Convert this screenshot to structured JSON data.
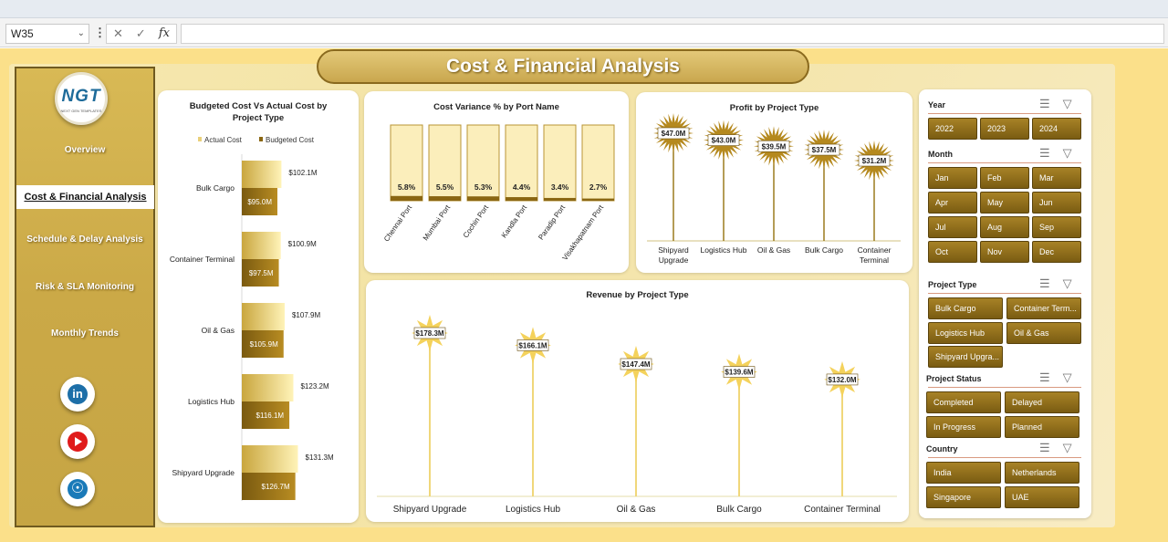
{
  "excel": {
    "name_box": "W35",
    "fx_label": "fx"
  },
  "title": "Cost & Financial Analysis",
  "logo": {
    "text": "NGT",
    "sub": "NEXT GEN TEMPLATES"
  },
  "nav": [
    {
      "label": "Overview"
    },
    {
      "label": "Cost & Financial Analysis"
    },
    {
      "label": "Schedule & Delay Analysis"
    },
    {
      "label": "Risk & SLA Monitoring"
    },
    {
      "label": "Monthly Trends"
    }
  ],
  "social": {
    "linkedin": "in"
  },
  "colors": {
    "gold_dark": "#8a6612",
    "gold_light": "#f4e3a0",
    "stem": "#b8922a"
  },
  "charts": {
    "budget": {
      "title_line1": "Budgeted Cost Vs Actual Cost by",
      "title_line2": "Project Type",
      "legend_actual": "Actual Cost",
      "legend_budget": "Budgeted Cost",
      "labels": [
        "$102.1M",
        "$95.0M",
        "$100.9M",
        "$97.5M",
        "$107.9M",
        "$105.9M",
        "$123.2M",
        "$116.1M",
        "$131.3M",
        "$126.7M"
      ]
    },
    "variance": {
      "title": "Cost Variance % by Port Name",
      "labels": [
        "5.8%",
        "5.5%",
        "5.3%",
        "4.4%",
        "3.4%",
        "2.7%"
      ]
    },
    "profit": {
      "title": "Profit by Project Type",
      "labels": [
        "$47.0M",
        "$43.0M",
        "$39.5M",
        "$37.5M",
        "$31.2M"
      ]
    },
    "revenue": {
      "title": "Revenue by Project Type",
      "labels": [
        "$178.3M",
        "$166.1M",
        "$147.4M",
        "$139.6M",
        "$132.0M"
      ]
    }
  },
  "chart_data": [
    {
      "type": "bar",
      "title": "Budgeted Cost Vs Actual Cost by Project Type",
      "categories": [
        "Bulk Cargo",
        "Container Terminal",
        "Oil & Gas",
        "Logistics Hub",
        "Shipyard Upgrade"
      ],
      "series": [
        {
          "name": "Actual Cost",
          "values": [
            102.1,
            100.9,
            107.9,
            123.2,
            131.3
          ]
        },
        {
          "name": "Budgeted Cost",
          "values": [
            95.0,
            97.5,
            105.9,
            116.1,
            126.7
          ]
        }
      ],
      "unit": "$M",
      "orientation": "horizontal",
      "legend": "top"
    },
    {
      "type": "bar",
      "title": "Cost Variance % by Port Name",
      "categories": [
        "Chennai Port",
        "Mumbai Port",
        "Cochin Port",
        "Kandla Port",
        "Paradip Port",
        "Visakhapatnam Port"
      ],
      "values": [
        5.8,
        5.5,
        5.3,
        4.4,
        3.4,
        2.7
      ],
      "unit": "%"
    },
    {
      "type": "bar",
      "title": "Profit by Project Type",
      "categories": [
        "Shipyard Upgrade",
        "Logistics Hub",
        "Oil & Gas",
        "Bulk Cargo",
        "Container Terminal"
      ],
      "values": [
        47.0,
        43.0,
        39.5,
        37.5,
        31.2
      ],
      "unit": "$M"
    },
    {
      "type": "bar",
      "title": "Revenue by Project Type",
      "categories": [
        "Shipyard Upgrade",
        "Logistics Hub",
        "Oil & Gas",
        "Bulk Cargo",
        "Container Terminal"
      ],
      "values": [
        178.3,
        166.1,
        147.4,
        139.6,
        132.0
      ],
      "unit": "$M"
    }
  ],
  "slicers": {
    "year": {
      "title": "Year",
      "items": [
        "2022",
        "2023",
        "2024"
      ]
    },
    "month": {
      "title": "Month",
      "items": [
        "Jan",
        "Feb",
        "Mar",
        "Apr",
        "May",
        "Jun",
        "Jul",
        "Aug",
        "Sep",
        "Oct",
        "Nov",
        "Dec"
      ]
    },
    "ptype": {
      "title": "Project Type",
      "items": [
        "Bulk Cargo",
        "Container Term...",
        "Logistics Hub",
        "Oil & Gas",
        "Shipyard Upgra..."
      ]
    },
    "pstatus": {
      "title": "Project Status",
      "items": [
        "Completed",
        "Delayed",
        "In Progress",
        "Planned"
      ]
    },
    "country": {
      "title": "Country",
      "items": [
        "India",
        "Netherlands",
        "Singapore",
        "UAE"
      ]
    }
  }
}
